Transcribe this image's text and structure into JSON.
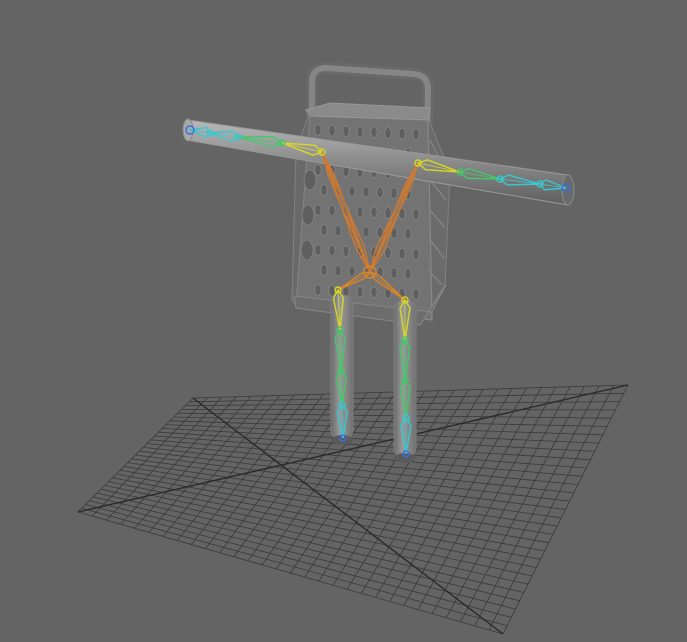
{
  "viewport": {
    "background": "#646464",
    "grid_color": "#3a3a3a",
    "grid_axis_color": "#2a2a2a"
  },
  "scene": {
    "object": "cheese-grater",
    "rig": "biped-skeleton",
    "joint_colors": {
      "root": "#d9852a",
      "spine": "#cc7a33",
      "upper": "#d6d62a",
      "mid": "#44c86a",
      "lower": "#38c8d0",
      "end": "#3a6ee0"
    }
  }
}
